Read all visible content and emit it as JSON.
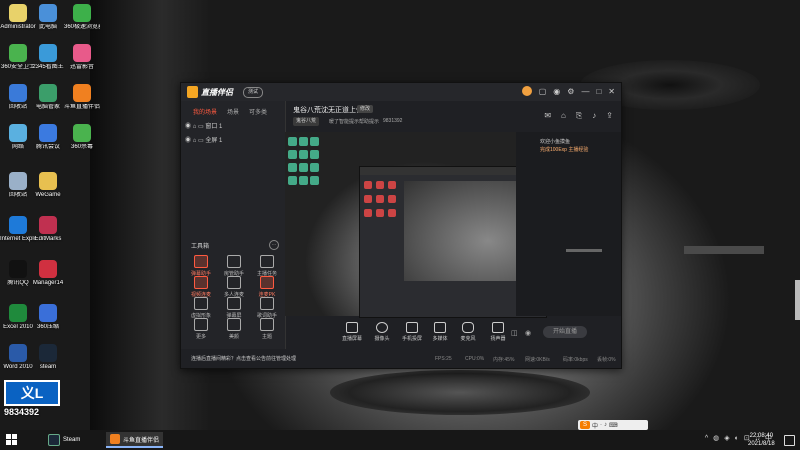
{
  "desktop": {
    "icons": [
      {
        "label": "Administrator",
        "color": "#e8d26a"
      },
      {
        "label": "此电脑",
        "color": "#4a90d9"
      },
      {
        "label": "360极速浏览器",
        "color": "#3db04a"
      },
      {
        "label": "360安全卫士",
        "color": "#4ab34e"
      },
      {
        "label": "2345看图王",
        "color": "#3a9ad9"
      },
      {
        "label": "迅雷影音",
        "color": "#e85a8a"
      },
      {
        "label": "回收站",
        "color": "#3a7ad9"
      },
      {
        "label": "电脑管家",
        "color": "#3b9e6a"
      },
      {
        "label": "斗鱼直播伴侣",
        "color": "#f08020"
      },
      {
        "label": "网络",
        "color": "#5ab0e0"
      },
      {
        "label": "腾讯会议",
        "color": "#3b7ae0"
      },
      {
        "label": "360杀毒",
        "color": "#4ab34e"
      },
      {
        "label": "回收站",
        "color": "#9ab0c8"
      },
      {
        "label": "WeGame",
        "color": "#e8c050"
      },
      {
        "label": "Internet Explorer",
        "color": "#1e7ad9"
      },
      {
        "label": "EditMarks",
        "color": "#c03050"
      },
      {
        "label": "腾讯QQ",
        "color": "#111111"
      },
      {
        "label": "Manager14",
        "color": "#d03040"
      },
      {
        "label": "Excel 2010",
        "color": "#1f8a3c"
      },
      {
        "label": "360压缩",
        "color": "#3a6fd9"
      },
      {
        "label": "Word 2010",
        "color": "#2a5aa8"
      },
      {
        "label": "steam",
        "color": "#1b2838"
      }
    ],
    "counter_value": "9834392",
    "counter_glyph": "义L"
  },
  "app": {
    "title": "直播伴侣",
    "version_badge": "测试",
    "left_tabs": [
      "我的场景",
      "场景",
      "可多类"
    ],
    "scenes": [
      {
        "name": "窗口 1"
      },
      {
        "name": "全屏 1"
      }
    ],
    "tools_title": "工具箱",
    "tools": [
      {
        "label": "弹幕助手",
        "highlight": true
      },
      {
        "label": "房管助手",
        "highlight": false
      },
      {
        "label": "主播任务",
        "highlight": false
      },
      {
        "label": "视频连麦",
        "highlight": true
      },
      {
        "label": "多人连麦",
        "highlight": false
      },
      {
        "label": "连麦PK",
        "highlight": true
      },
      {
        "label": "虚拟形象",
        "highlight": false
      },
      {
        "label": "弹幕屏",
        "highlight": false
      },
      {
        "label": "歌词助手",
        "highlight": false
      },
      {
        "label": "更多",
        "highlight": false
      },
      {
        "label": "美颜",
        "highlight": false
      },
      {
        "label": "主题",
        "highlight": false
      }
    ],
    "notice": "连播后直播间精彩？点击查看公告前往管理处理",
    "room": {
      "title": "鬼谷八荒沈无正道上修",
      "badge": "修改",
      "category": "鬼谷八荒",
      "id_label": "暖了智能提示帮助提示",
      "room_number": "9831392"
    },
    "chat": {
      "msg1": "欢迎小鱼摸鱼",
      "msg2": "完成100Exp 主播经验"
    },
    "controls": [
      {
        "label": "直播屏幕"
      },
      {
        "label": "摄像头"
      },
      {
        "label": "手机投屏"
      },
      {
        "label": "多媒体"
      },
      {
        "label": "麦克风"
      },
      {
        "label": "扬声器"
      }
    ],
    "go_live": "开始直播",
    "status": {
      "fps": "FPS:25",
      "cpu": "CPU:0%",
      "mem": "内存:45%",
      "net": "网速:0KB/s",
      "bitrate": "码率:0kbps",
      "frames": "丢帧:0%"
    }
  },
  "taskbar": {
    "apps": [
      {
        "label": "Steam",
        "color": "#1b2838"
      },
      {
        "label": "斗鱼直播伴侣",
        "color": "#f08020"
      }
    ],
    "ime": {
      "lang": "中",
      "marks": "·"
    },
    "time": "22:08:40",
    "date": "2021/8/18"
  }
}
